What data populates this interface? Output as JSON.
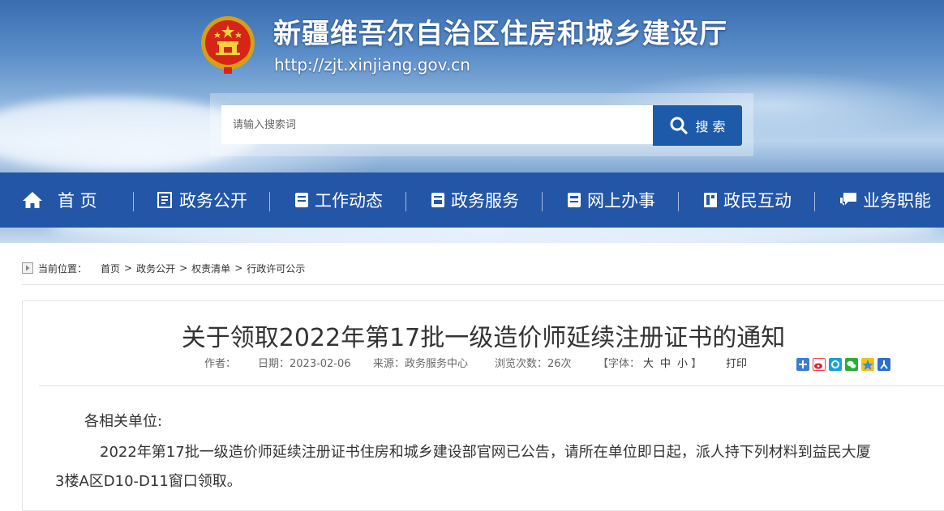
{
  "header": {
    "site_title": "新疆维吾尔自治区住房和城乡建设厅",
    "site_url": "http://zjt.xinjiang.gov.cn"
  },
  "search": {
    "placeholder": "请输入搜索词",
    "button_label": "搜 索"
  },
  "nav": {
    "items": [
      {
        "label": "首  页",
        "icon": "home-icon"
      },
      {
        "label": "政务公开",
        "icon": "document-icon"
      },
      {
        "label": "工作动态",
        "icon": "news-icon"
      },
      {
        "label": "政务服务",
        "icon": "service-icon"
      },
      {
        "label": "网上办事",
        "icon": "online-icon"
      },
      {
        "label": "政民互动",
        "icon": "interaction-icon"
      },
      {
        "label": "业务职能",
        "icon": "chat-icon"
      }
    ]
  },
  "breadcrumb": {
    "label": "当前位置：",
    "items": [
      "首页",
      "政务公开",
      "权责清单",
      "行政许可公示"
    ],
    "separator": ">"
  },
  "article": {
    "title": "关于领取2022年第17批一级造价师延续注册证书的通知",
    "author_label": "作者：",
    "author": "",
    "date_label": "日期：",
    "date": "2023-02-06",
    "source_label": "来源：",
    "source": "政务服务中心",
    "views_label": "浏览次数：",
    "views": "26次",
    "font_label": "【字体：",
    "font_large": "大",
    "font_medium": "中",
    "font_small": "小",
    "font_close": "】",
    "print_label": "打印",
    "greeting": "各相关单位:",
    "paragraph_line1": "2022年第17批一级造价师延续注册证书住房和城乡建设部官网已公告，请所在单位即日起，派人持下列材料到益民大厦",
    "paragraph_line2": "3楼A区D10-D11窗口领取。"
  },
  "colors": {
    "nav_bg": "#2356a6",
    "search_button": "#1d5aaa"
  }
}
